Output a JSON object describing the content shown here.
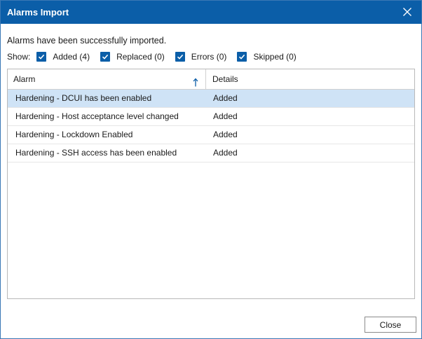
{
  "window": {
    "title": "Alarms Import"
  },
  "message": "Alarms have been successfully imported.",
  "filters": {
    "show_label": "Show:",
    "items": [
      {
        "label": "Added (4)",
        "checked": true
      },
      {
        "label": "Replaced (0)",
        "checked": true
      },
      {
        "label": "Errors (0)",
        "checked": true
      },
      {
        "label": "Skipped (0)",
        "checked": true
      }
    ]
  },
  "table": {
    "columns": [
      "Alarm",
      "Details"
    ],
    "sort": {
      "column": "Alarm",
      "direction": "ascending",
      "icon": "sort-ascending-arrow-icon"
    },
    "rows": [
      {
        "alarm": "Hardening - DCUI has been enabled",
        "details": "Added",
        "selected": true
      },
      {
        "alarm": "Hardening - Host acceptance level changed",
        "details": "Added"
      },
      {
        "alarm": "Hardening - Lockdown Enabled",
        "details": "Added"
      },
      {
        "alarm": "Hardening - SSH access has been enabled",
        "details": "Added"
      }
    ]
  },
  "footer": {
    "close_label": "Close"
  },
  "colors": {
    "titlebar": "#0b5ea8",
    "checkbox": "#0b5ea8",
    "selected_row": "#cfe3f6"
  }
}
